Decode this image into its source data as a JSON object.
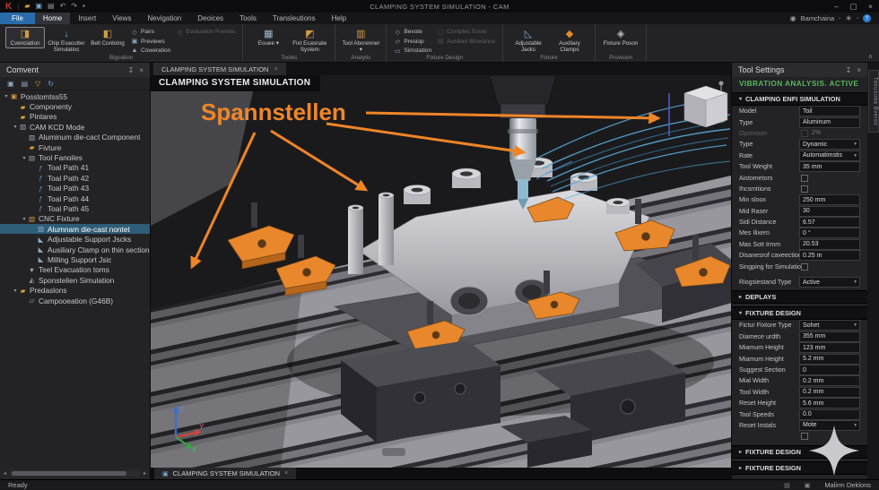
{
  "window": {
    "title": "CLAMPING SYSTEM SIMULATION - CAM",
    "quick_access": [
      "app-logo",
      "open-folder-icon",
      "save-icon",
      "print-icon",
      "undo-icon",
      "redo-icon",
      "pin-icon"
    ],
    "controls": [
      "minimize",
      "maximize",
      "close"
    ],
    "account": "Bamchaina"
  },
  "menu": {
    "items": [
      {
        "label": "File",
        "style": "file"
      },
      {
        "label": "Home",
        "style": "active"
      },
      {
        "label": "Insert",
        "style": ""
      },
      {
        "label": "Views",
        "style": ""
      },
      {
        "label": "Nevigation",
        "style": ""
      },
      {
        "label": "Deoices",
        "style": ""
      },
      {
        "label": "Tools",
        "style": ""
      },
      {
        "label": "Transleutions",
        "style": ""
      },
      {
        "label": "Help",
        "style": ""
      }
    ]
  },
  "ribbon": {
    "groups": [
      {
        "label": "Bigoation",
        "columns": [
          {
            "kind": "big",
            "buttons": [
              {
                "label": "Cvenciation",
                "icon": "orientation-icon",
                "selected": true
              }
            ]
          },
          {
            "kind": "big",
            "buttons": [
              {
                "label": "Chip Evacutter Simulatioc",
                "icon": "chip-evacutter-icon"
              }
            ]
          },
          {
            "kind": "big",
            "buttons": [
              {
                "label": "Bell Contoing",
                "icon": "bell-contoing-icon"
              }
            ]
          },
          {
            "kind": "small",
            "buttons": [
              {
                "label": "Pairs",
                "icon": "pairs-icon"
              },
              {
                "label": "Previews",
                "icon": "previews-icon"
              },
              {
                "label": "Coweration",
                "icon": "coweration-icon"
              }
            ]
          },
          {
            "kind": "small",
            "buttons": [
              {
                "label": "Evaluation Premits",
                "icon": "evaluation-premits-icon",
                "disabled": true
              }
            ]
          }
        ]
      },
      {
        "label": "Tooles",
        "columns": [
          {
            "kind": "big",
            "buttons": [
              {
                "label": "Eouee",
                "icon": "eouee-icon",
                "dropdown": true
              }
            ]
          },
          {
            "kind": "big",
            "buttons": [
              {
                "label": "Fixt Ecasnate System",
                "icon": "fixt-ecasnate-icon"
              }
            ]
          }
        ]
      },
      {
        "label": "Analytis",
        "columns": [
          {
            "kind": "big",
            "buttons": [
              {
                "label": "Tool Abcrenner",
                "icon": "tool-abcrenner-icon",
                "dropdown": true
              }
            ]
          }
        ]
      },
      {
        "label": "Fixture Design",
        "columns": [
          {
            "kind": "small",
            "buttons": [
              {
                "label": "Bevote",
                "icon": "bevote-icon"
              },
              {
                "label": "Presiop",
                "icon": "presiop-icon"
              },
              {
                "label": "Simstation",
                "icon": "simstation-icon"
              }
            ]
          },
          {
            "kind": "small",
            "buttons": [
              {
                "label": "Complec Eoste",
                "icon": "complec-eoste-icon",
                "disabled": true
              },
              {
                "label": "Ausiliart Blowance",
                "icon": "ausiliart-blowance-icon",
                "disabled": true
              }
            ]
          }
        ]
      },
      {
        "label": "Fixture",
        "columns": [
          {
            "kind": "big",
            "buttons": [
              {
                "label": "Adjustable Jacks",
                "icon": "adjustable-jacks-icon"
              }
            ]
          },
          {
            "kind": "big",
            "buttons": [
              {
                "label": "Auxiliary Clamps",
                "icon": "auxiliary-clamps-icon"
              }
            ]
          }
        ]
      },
      {
        "label": "Provision",
        "columns": [
          {
            "kind": "big",
            "buttons": [
              {
                "label": "Fixture Poson",
                "icon": "fixture-poson-icon"
              }
            ]
          }
        ]
      }
    ]
  },
  "left_panel": {
    "title": "Comvent",
    "toolbar_icons": [
      "copy-icon",
      "details-icon",
      "filter-icon",
      "refresh-icon"
    ],
    "tree": [
      {
        "label": "Posstomtss55",
        "depth": 0,
        "icon": "root-assembly-icon",
        "expand": "open"
      },
      {
        "label": "Componenty",
        "depth": 1,
        "icon": "folder-icon"
      },
      {
        "label": "Pintares",
        "depth": 1,
        "icon": "folder-icon"
      },
      {
        "label": "CAM KCD Mode",
        "depth": 1,
        "icon": "cam-mode-icon",
        "expand": "open"
      },
      {
        "label": "Aluminum die-cact Component",
        "depth": 2,
        "icon": "part-icon"
      },
      {
        "label": "Fivture",
        "depth": 2,
        "icon": "fixture-folder-icon"
      },
      {
        "label": "Tool Fanoiles",
        "depth": 2,
        "icon": "tool-families-icon",
        "expand": "open"
      },
      {
        "label": "Toal Path 41",
        "depth": 3,
        "icon": "toolpath-icon"
      },
      {
        "label": "Toal Path 42",
        "depth": 3,
        "icon": "toolpath-icon"
      },
      {
        "label": "Toal Path 43",
        "depth": 3,
        "icon": "toolpath-icon"
      },
      {
        "label": "Toal Path 44",
        "depth": 3,
        "icon": "toolpath-icon"
      },
      {
        "label": "Toal Path 45",
        "depth": 3,
        "icon": "toolpath-icon"
      },
      {
        "label": "CNC Fixture",
        "depth": 2,
        "icon": "cnc-fixture-icon",
        "expand": "open"
      },
      {
        "label": "Alumnam die-cast nontet",
        "depth": 3,
        "icon": "part-icon",
        "selected": true
      },
      {
        "label": "Adjustable Support Jscks",
        "depth": 3,
        "icon": "jack-icon"
      },
      {
        "label": "Ausiliary Clamp on thin sections",
        "depth": 3,
        "icon": "clamp-item-icon"
      },
      {
        "label": "Milling Support Jsic",
        "depth": 3,
        "icon": "jack-icon"
      },
      {
        "label": "Teel Evacuation toms",
        "depth": 2,
        "icon": "evacuation-icon"
      },
      {
        "label": "Sponstelien Simulation",
        "depth": 2,
        "icon": "simulation-icon"
      },
      {
        "label": "Predaslons",
        "depth": 1,
        "icon": "folder-icon",
        "expand": "open"
      },
      {
        "label": "Campooeation (G46B)",
        "depth": 2,
        "icon": "report-icon"
      }
    ]
  },
  "viewport": {
    "tab": "CLAMPING SYSTEM SIMULATION",
    "overlay_title": "CLAMPING SYSTEM SIMULATION",
    "annotation": "Spannstellen",
    "bottom_tab": "CLAMPING SYSTEM SIMULATION",
    "axes": {
      "z": "Z",
      "y": "Y",
      "x": "X"
    }
  },
  "right_panel": {
    "title": "Tool Settings",
    "status": "VIBRATION ANALYSIS. ACTIVE",
    "sections": [
      {
        "title": "CLAMPING ENFI SIMULATION",
        "collapsed": false,
        "fields": [
          {
            "label": "Model",
            "value": "Toil",
            "type": "text"
          },
          {
            "label": "Type",
            "value": "Aluminum",
            "type": "text"
          },
          {
            "label": "Opomoon",
            "value": "2%",
            "type": "check-disabled"
          },
          {
            "label": "Type",
            "value": "Dynamic",
            "type": "select"
          },
          {
            "label": "Rate",
            "value": "Automatimstis",
            "type": "select"
          },
          {
            "label": "Tool Weight",
            "value": "35 mm",
            "type": "text"
          },
          {
            "label": "Aistometors",
            "type": "check"
          },
          {
            "label": "Ihcsmitions",
            "type": "check"
          },
          {
            "label": "Min sloox",
            "value": "250 mm",
            "type": "text"
          },
          {
            "label": "Mid Raser",
            "value": "30",
            "type": "text"
          },
          {
            "label": "Sidi Distance",
            "value": "6.57",
            "type": "text"
          },
          {
            "label": "Mes Ilixem",
            "value": "0 °",
            "type": "text"
          },
          {
            "label": "Mas Sott Irmm",
            "value": "20.53",
            "type": "text"
          },
          {
            "label": "Disanesrof caveection",
            "value": "0.25 m",
            "type": "text"
          },
          {
            "label": "Singping for Simulation",
            "type": "check"
          },
          {
            "type": "gap"
          },
          {
            "label": "Riogsiestand Type",
            "value": "Active",
            "type": "select"
          }
        ]
      },
      {
        "title": "DEPLAYS",
        "collapsed": true
      },
      {
        "title": "FIXTURE DESIGN",
        "collapsed": false,
        "fields": [
          {
            "label": "Fictur Fixtore Type",
            "value": "Sohet",
            "type": "select"
          },
          {
            "label": "Diamece urdth",
            "value": "355 mm",
            "type": "text"
          },
          {
            "label": "Miamum Height",
            "value": "123 mm",
            "type": "text"
          },
          {
            "label": "Miamum Height",
            "value": "5.2 mm",
            "type": "text"
          },
          {
            "label": "Suggest Section",
            "value": "0",
            "type": "text"
          },
          {
            "label": "Mial Width",
            "value": "0.2 mm",
            "type": "text"
          },
          {
            "label": "Tool Width",
            "value": "0.2 mm",
            "type": "text"
          },
          {
            "label": "Reset Height",
            "value": "5.6 mm",
            "type": "text"
          },
          {
            "label": "Tool Speeds",
            "value": "0.0",
            "type": "text"
          },
          {
            "label": "Reset Instals",
            "value": "Mote",
            "type": "select"
          },
          {
            "label": "",
            "type": "check"
          }
        ]
      },
      {
        "title": "FIXTURE DESIGN",
        "collapsed": true
      },
      {
        "title": "FIXTURE DESIGN",
        "collapsed": true
      }
    ]
  },
  "side_tab": {
    "label": "Tasusuna Bveiso"
  },
  "status_bar": {
    "ready": "Ready",
    "right_text": "Malirm Deklons",
    "icons": [
      "panel-icon",
      "grid-icon"
    ]
  },
  "colors": {
    "accent_orange": "#f08728",
    "clamp_orange": "#e8872b",
    "status_green": "#56b75a",
    "selection_blue": "#2e5d77",
    "coolant_blue": "#5aa7d6",
    "file_tab_blue": "#2a6cab"
  }
}
